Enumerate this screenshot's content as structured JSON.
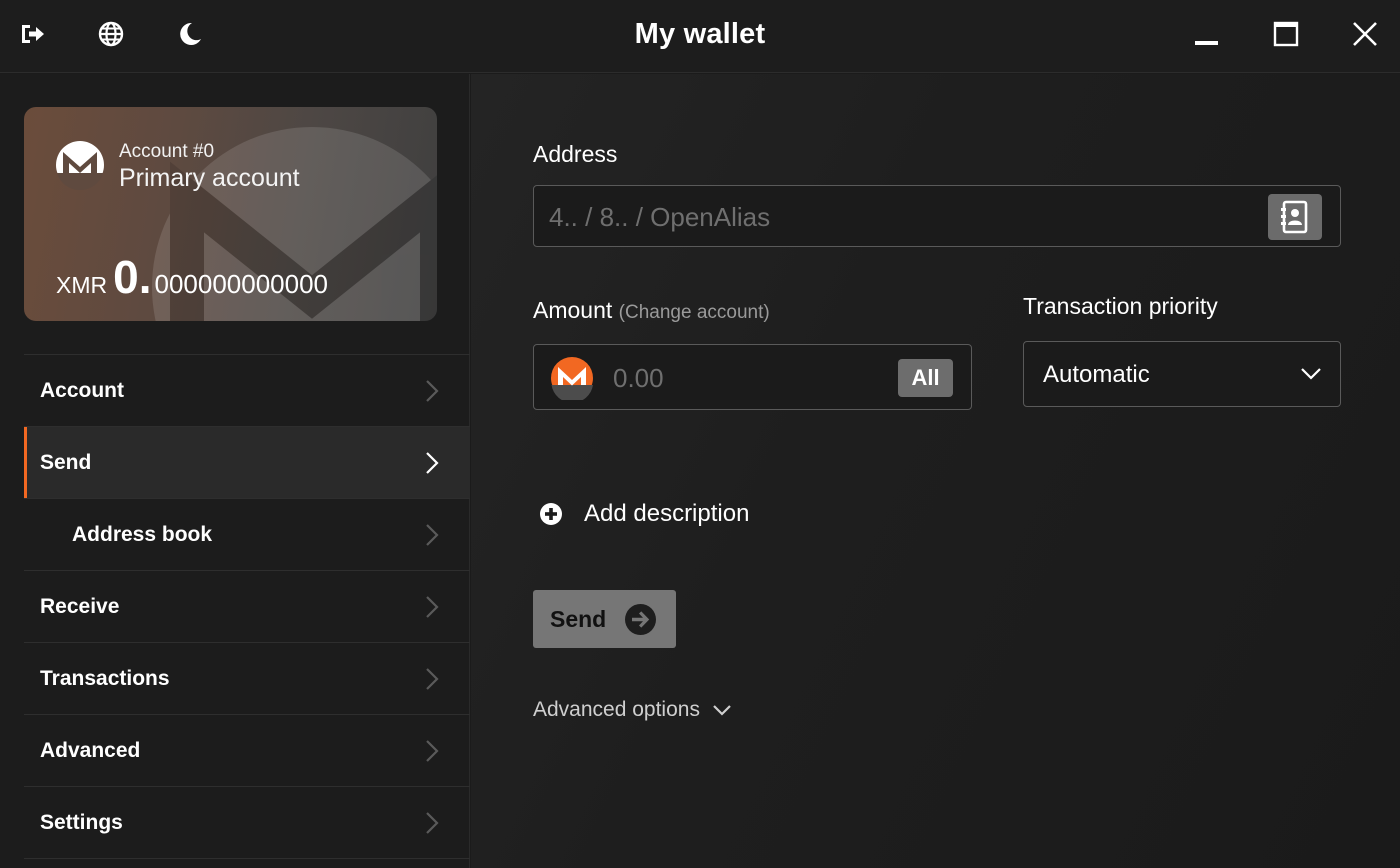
{
  "window": {
    "title": "My wallet",
    "icons": [
      "logout-icon",
      "globe-icon",
      "moon-icon",
      "minimize-icon",
      "maximize-icon",
      "close-icon"
    ]
  },
  "account_card": {
    "account_number": "Account #0",
    "account_name": "Primary account",
    "currency": "XMR",
    "balance_integer": "0.",
    "balance_decimal": "000000000000"
  },
  "sidebar": {
    "items": [
      {
        "label": "Account",
        "active": false,
        "sub": false
      },
      {
        "label": "Send",
        "active": true,
        "sub": false
      },
      {
        "label": "Address book",
        "active": false,
        "sub": true
      },
      {
        "label": "Receive",
        "active": false,
        "sub": false
      },
      {
        "label": "Transactions",
        "active": false,
        "sub": false
      },
      {
        "label": "Advanced",
        "active": false,
        "sub": false
      },
      {
        "label": "Settings",
        "active": false,
        "sub": false
      }
    ]
  },
  "send_form": {
    "address_label": "Address",
    "address_placeholder": "4.. / 8.. / OpenAlias",
    "amount_label": "Amount",
    "amount_hint": "(Change account)",
    "amount_placeholder": "0.00",
    "all_button": "All",
    "priority_label": "Transaction priority",
    "priority_value": "Automatic",
    "add_description": "Add description",
    "send_button": "Send",
    "advanced_options": "Advanced options"
  },
  "colors": {
    "accent": "#f26822",
    "background": "#1b1b1b",
    "button_gray": "#767676"
  }
}
